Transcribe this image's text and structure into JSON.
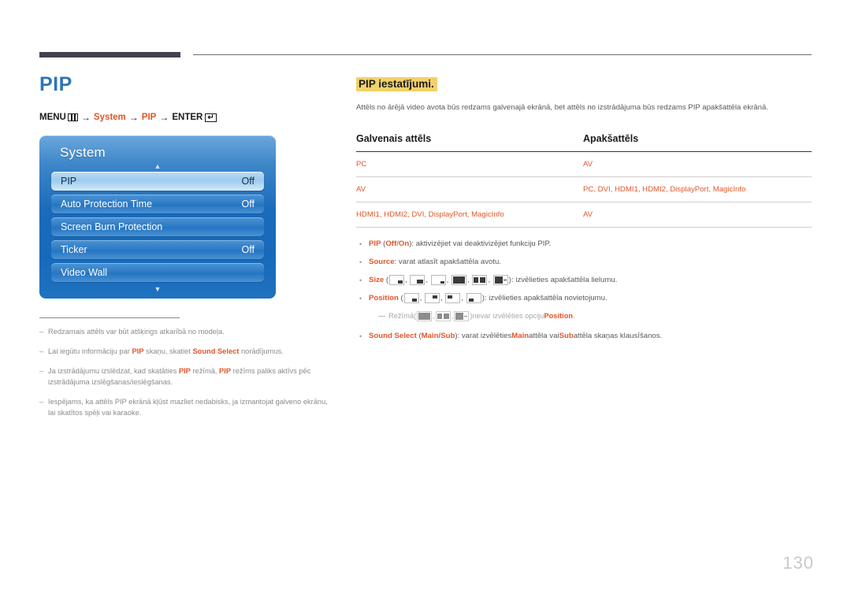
{
  "page": {
    "number": "130"
  },
  "left": {
    "title": "PIP",
    "menu_path": {
      "menu_label": "MENU",
      "arrow": "→",
      "system": "System",
      "pip": "PIP",
      "enter_label": "ENTER",
      "enter_glyph": "↵"
    },
    "osd": {
      "title": "System",
      "scroll_up": "▲",
      "scroll_down": "▼",
      "items": [
        {
          "label": "PIP",
          "value": "Off",
          "selected": true
        },
        {
          "label": "Auto Protection Time",
          "value": "Off",
          "selected": false
        },
        {
          "label": "Screen Burn Protection",
          "value": "",
          "selected": false
        },
        {
          "label": "Ticker",
          "value": "Off",
          "selected": false
        },
        {
          "label": "Video Wall",
          "value": "",
          "selected": false
        }
      ]
    },
    "footnotes": [
      {
        "dash": "–",
        "parts": [
          {
            "t": "Redzamais attēls var būt atšķirigs atkarībā no modeļa."
          }
        ]
      },
      {
        "dash": "–",
        "parts": [
          {
            "t": "Lai iegūtu informāciju par "
          },
          {
            "t": "PIP",
            "b": true
          },
          {
            "t": " skaņu, skatiet "
          },
          {
            "t": "Sound Select",
            "b": true
          },
          {
            "t": " norādījumus."
          }
        ]
      },
      {
        "dash": "–",
        "parts": [
          {
            "t": "Ja izstrādājumu izslēdzat, kad skatāties "
          },
          {
            "t": "PIP",
            "b": true
          },
          {
            "t": " režīmā, "
          },
          {
            "t": "PIP",
            "b": true
          },
          {
            "t": " režīms paliks aktīvs pēc izstrādājuma izslēgšanas/ieslēgšanas."
          }
        ]
      },
      {
        "dash": "–",
        "parts": [
          {
            "t": "Iespējams, ka attēls PIP ekrānā kļūst mazliet nedabisks, ja izmantojat galveno ekrānu, lai skatītos spēļi vai karaoke."
          }
        ]
      }
    ]
  },
  "right": {
    "heading": "PIP iestatījumi.",
    "intro": "Attēls no ārējā video avota būs redzams galvenajā ekrānā, bet attēls no izstrādājuma būs redzams PIP apakšattēla ekrānā.",
    "table": {
      "headers": [
        "Galvenais attēls",
        "Apakšattēls"
      ],
      "rows": [
        [
          "PC",
          "AV"
        ],
        [
          "AV",
          "PC, DVI, HDMI1, HDMI2, DisplayPort, MagicInfo"
        ],
        [
          "HDMI1, HDMI2, DVI, DisplayPort, MagicInfo",
          "AV"
        ]
      ]
    },
    "bullets": {
      "dot": "•",
      "pip": {
        "label": "PIP",
        "open_paren": " (",
        "off": "Off",
        "slash": "/",
        "on": "On",
        "rest": "): aktivizējiet vai deaktivizējiet funkciju PIP."
      },
      "source": {
        "label": "Source",
        "rest": ": varat atlasīt apakšattēla avotu."
      },
      "size": {
        "label": "Size",
        "open_paren": " (",
        "close_paren": ")",
        "rest": ": izvēlieties apakšattēla lielumu.",
        "icons": [
          "pip-size-small-icon",
          "pip-size-medium-icon",
          "pip-size-tiny-icon",
          "pip-split-even-icon",
          "pip-split-narrow-icon",
          "pip-split-wide-icon"
        ]
      },
      "position": {
        "label": "Position",
        "open_paren": " (",
        "close_paren": ")",
        "rest": ": izvēlieties apakšattēla novietojumu.",
        "icons": [
          "pip-pos-bottom-right-icon",
          "pip-pos-top-right-icon",
          "pip-pos-top-left-icon",
          "pip-pos-bottom-left-icon"
        ]
      },
      "mode_note": {
        "lead": "Režīmā",
        "open_paren": " (",
        "close_paren": ")",
        "middle": " nevar izvēlēties opciju ",
        "label": "Position",
        "period": ".",
        "icons": [
          "pip-split-even-icon",
          "pip-split-narrow-icon",
          "pip-split-wide-icon"
        ]
      },
      "sound_select": {
        "label": "Sound Select",
        "open_paren": " (",
        "main": "Main",
        "slash": "/",
        "sub": "Sub",
        "mid1": "): varat izvēlēties ",
        "main2": "Main",
        "mid2": " attēla vai ",
        "sub2": "Sub",
        "mid3": " attēla skaņas klausīšanos."
      }
    }
  },
  "colors": {
    "accent_orange": "#e2552a",
    "title_blue": "#2e75b6",
    "highlight_yellow": "#f1d16a",
    "rule_dark": "#46414f"
  }
}
